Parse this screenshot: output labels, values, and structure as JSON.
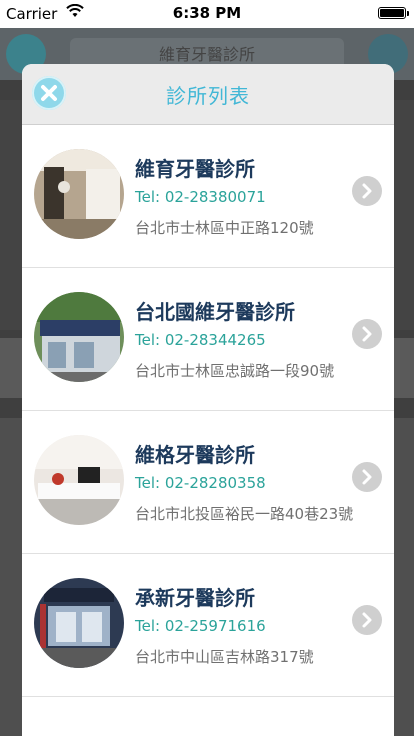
{
  "status_bar": {
    "carrier": "Carrier",
    "time": "6:38 PM"
  },
  "background": {
    "title": "維育牙醫診所"
  },
  "modal": {
    "title": "診所列表",
    "close_icon": "close-icon",
    "clinics": [
      {
        "name": "維育牙醫診所",
        "tel": "Tel: 02-28380071",
        "address": "台北市士林區中正路120號"
      },
      {
        "name": "台北國維牙醫診所",
        "tel": "Tel: 02-28344265",
        "address": "台北市士林區忠誠路一段90號"
      },
      {
        "name": "維格牙醫診所",
        "tel": "Tel: 02-28280358",
        "address": "台北市北投區裕民一路40巷23號"
      },
      {
        "name": "承新牙醫診所",
        "tel": "Tel: 02-25971616",
        "address": "台北市中山區吉林路317號"
      }
    ]
  },
  "colors": {
    "title_accent": "#41b7d6",
    "clinic_name": "#1d3a5c",
    "tel": "#2ba39a",
    "address": "#707070"
  }
}
